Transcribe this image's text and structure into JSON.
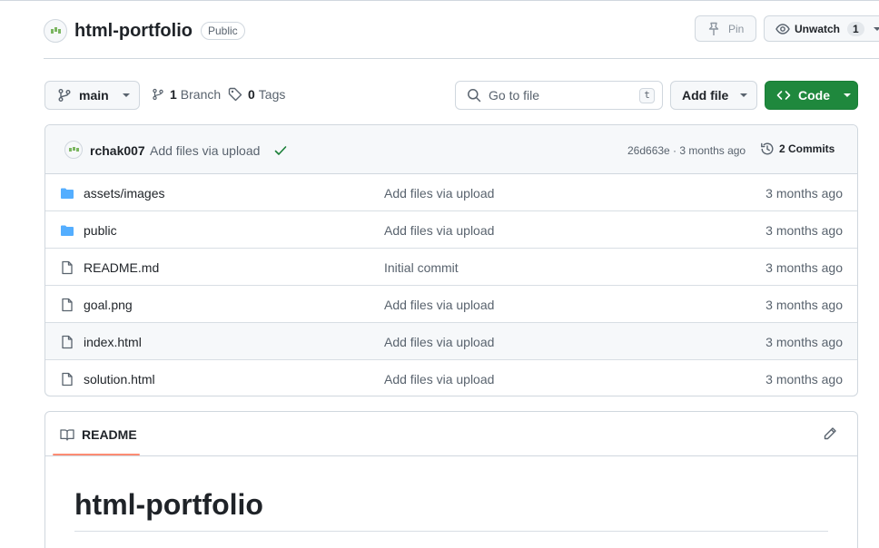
{
  "repo": {
    "name": "html-portfolio",
    "visibility": "Public",
    "pin_label": "Pin",
    "watch_label": "Unwatch",
    "watch_count": "1"
  },
  "nav": {
    "branch": "main",
    "branch_count": "1",
    "branch_label": "Branch",
    "tag_count": "0",
    "tag_label": "Tags",
    "search_placeholder": "Go to file",
    "search_shortcut": "t",
    "add_file_label": "Add file",
    "code_label": "Code"
  },
  "commit": {
    "author": "rchak007",
    "message": "Add files via upload",
    "sha_time": "26d663e · 3 months ago",
    "commits_label": "2 Commits"
  },
  "files": [
    {
      "name": "assets/images",
      "type": "folder",
      "message": "Add files via upload",
      "date": "3 months ago"
    },
    {
      "name": "public",
      "type": "folder",
      "message": "Add files via upload",
      "date": "3 months ago"
    },
    {
      "name": "README.md",
      "type": "file",
      "message": "Initial commit",
      "date": "3 months ago"
    },
    {
      "name": "goal.png",
      "type": "file",
      "message": "Add files via upload",
      "date": "3 months ago"
    },
    {
      "name": "index.html",
      "type": "file",
      "message": "Add files via upload",
      "date": "3 months ago"
    },
    {
      "name": "solution.html",
      "type": "file",
      "message": "Add files via upload",
      "date": "3 months ago"
    }
  ],
  "readme": {
    "tab_label": "README",
    "heading": "html-portfolio"
  },
  "colors": {
    "accent_green": "#1f883d",
    "folder_blue": "#54aeff",
    "tab_underline": "#fd8c73",
    "check_green": "#1a7f37"
  }
}
